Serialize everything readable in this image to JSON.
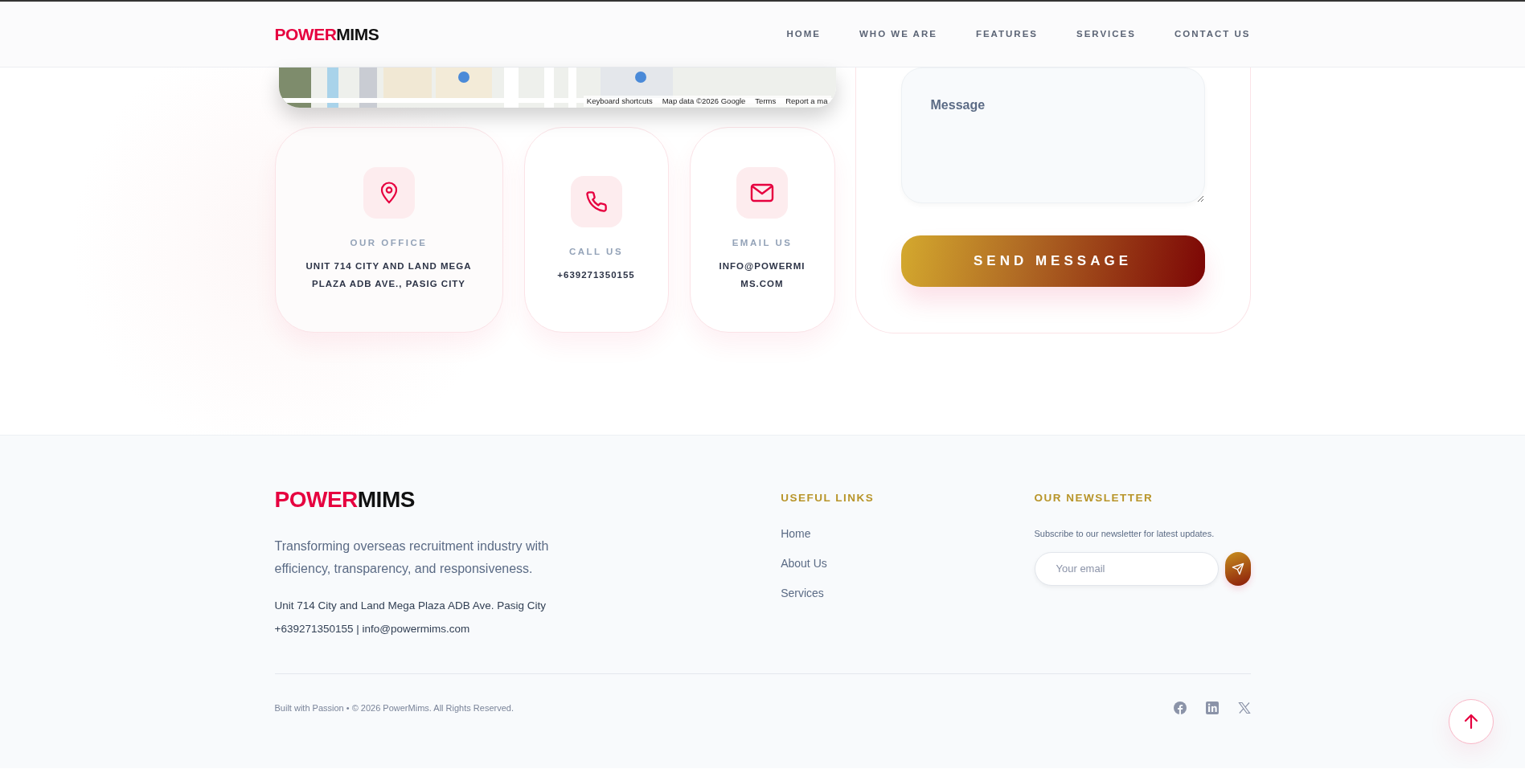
{
  "header": {
    "logo": {
      "part_1": "POWER",
      "part_2": "MIMS"
    },
    "nav": [
      {
        "label": "HOME"
      },
      {
        "label": "WHO WE ARE"
      },
      {
        "label": "FEATURES"
      },
      {
        "label": "SERVICES"
      },
      {
        "label": "CONTACT US"
      }
    ]
  },
  "map": {
    "kind": "picture",
    "attribution": [
      "Keyboard shortcuts",
      "Map data ©2026 Google",
      "Terms",
      "Report a ma"
    ]
  },
  "contact_cards": [
    {
      "kind": "office",
      "title": "OUR OFFICE",
      "text": "UNIT 714 CITY AND LAND MEGA PLAZA ADB AVE., PASIG CITY"
    },
    {
      "kind": "phone",
      "title": "CALL US",
      "text": "+639271350155"
    },
    {
      "kind": "email",
      "title": "EMAIL US",
      "text": "INFO@POWERMIMS.COM"
    }
  ],
  "form": {
    "message_placeholder": "Message",
    "submit": "SEND MESSAGE"
  },
  "footer": {
    "logo": {
      "part_1": "POWER",
      "part_2": "MIMS"
    },
    "tagline": "Transforming overseas recruitment industry with efficiency, transparency, and responsiveness.",
    "address": "Unit 714 City and Land Mega Plaza ADB Ave. Pasig City",
    "contact_line": "+639271350155 | info@powermims.com",
    "useful_links": {
      "title": "USEFUL LINKS",
      "links": [
        "Home",
        "About Us",
        "Services"
      ]
    },
    "newsletter": {
      "title": "OUR NEWSLETTER",
      "text": "Subscribe to our newsletter for latest updates.",
      "placeholder": "Your email"
    },
    "copyright": "Built with Passion • © 2026 PowerMims. All Rights Reserved.",
    "social": [
      {
        "kind": "facebook"
      },
      {
        "kind": "linkedin"
      },
      {
        "kind": "x"
      }
    ]
  }
}
